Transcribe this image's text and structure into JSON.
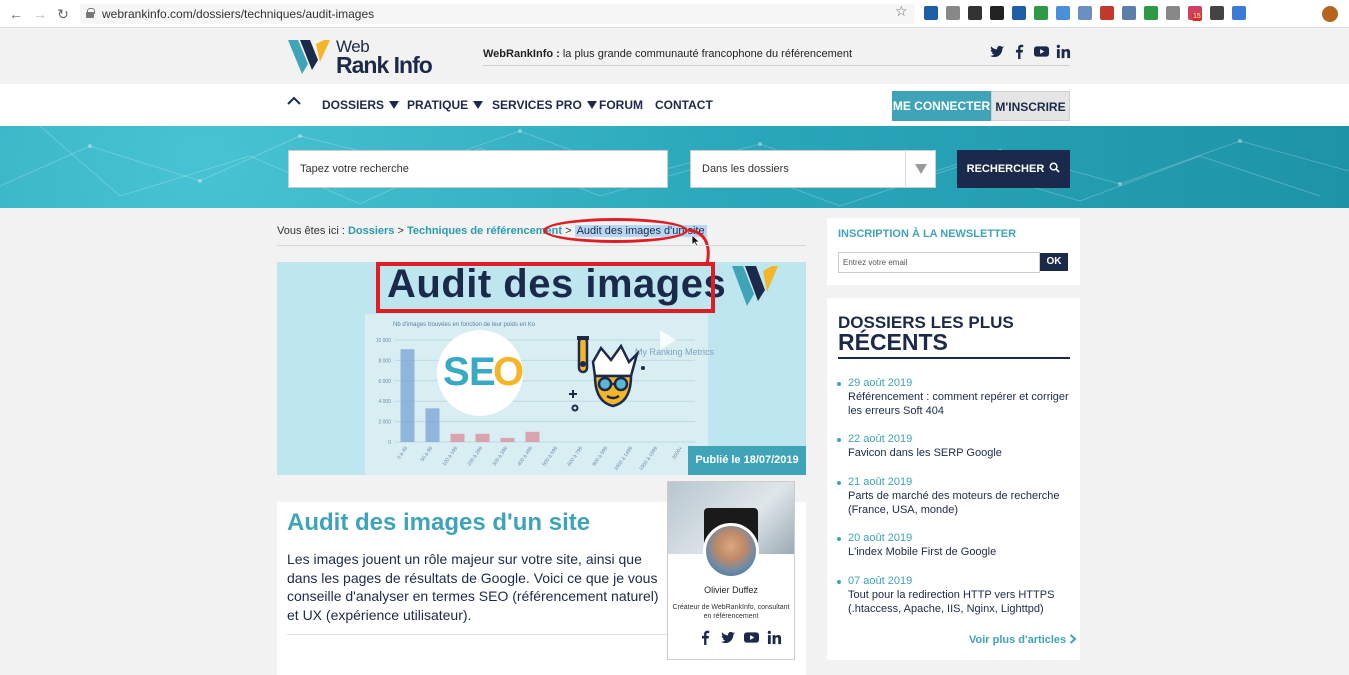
{
  "browser": {
    "url": "webrankinfo.com/dossiers/techniques/audit-images",
    "ext_badge": "15",
    "ext_colors": [
      "#1f5fa8",
      "#888888",
      "#333333",
      "#222222",
      "#1f5fa8",
      "#2e9a46",
      "#4a90d9",
      "#6a8fc0",
      "#c0392b",
      "#5b7fa8",
      "#2e9a46",
      "#888888",
      "#d04060",
      "#444444",
      "#3a7bd5"
    ]
  },
  "header": {
    "logo_web": "Web",
    "logo_rank_info": "Rank Info",
    "tagline_brand": "WebRankInfo :",
    "tagline_text": " la plus grande communauté francophone du référencement",
    "social": [
      "twitter-icon",
      "facebook-icon",
      "youtube-icon",
      "linkedin-icon"
    ]
  },
  "nav": {
    "items": [
      "DOSSIERS",
      "PRATIQUE",
      "SERVICES PRO",
      "FORUM",
      "CONTACT"
    ],
    "connect": "ME CONNECTER",
    "register": "M'INSCRIRE"
  },
  "search": {
    "placeholder": "Tapez votre recherche",
    "scope": "Dans les dossiers",
    "button": "RECHERCHER"
  },
  "breadcrumb": {
    "prefix": "Vous êtes ici : ",
    "level1": "Dossiers",
    "sep": " > ",
    "level2": "Techniques de référencement",
    "current": "Audit des images d'un site"
  },
  "hero_image": {
    "title": "Audit des images",
    "chart_caption": "Nb d'images trouvées en fonction de leur poids en Ko",
    "watermark": "My Ranking Metrics",
    "y_ticks": [
      "10 000",
      "8 000",
      "6 000",
      "4 000",
      "2 000",
      "0"
    ],
    "x_ticks": [
      "0 à 49",
      "50 à 99",
      "100 à 199",
      "200 à 299",
      "300 à 399",
      "400 à 499",
      "500 à 599",
      "600 à 799",
      "800 à 999",
      "1000 à 1499",
      "1500 à 1999",
      "2000+"
    ],
    "bars": [
      9100,
      3300,
      800,
      800,
      400,
      1000
    ],
    "seo": [
      "S",
      "E",
      "O"
    ]
  },
  "published": "Publié le 18/07/2019",
  "article": {
    "title": "Audit des images d'un site",
    "intro": "Les images jouent un rôle majeur sur votre site, ainsi que dans les pages de résultats de Google. Voici ce que je vous conseille d'analyser en termes SEO (référencement naturel) et UX (expérience utilisateur)."
  },
  "author": {
    "name": "Olivier Duffez",
    "role": "Créateur de WebRankInfo, consultant en référencement",
    "social": [
      "facebook-icon",
      "twitter-icon",
      "youtube-icon",
      "linkedin-icon"
    ]
  },
  "newsletter": {
    "title": "INSCRIPTION À LA NEWSLETTER",
    "placeholder": "Entrez votre email",
    "ok": "OK"
  },
  "recent": {
    "heading_small": "DOSSIERS LES PLUS",
    "heading_big": "RÉCENTS",
    "items": [
      {
        "date": "29 août 2019",
        "title": "Référencement : comment repérer et corriger les erreurs Soft 404"
      },
      {
        "date": "22 août 2019",
        "title": "Favicon dans les SERP Google"
      },
      {
        "date": "21 août 2019",
        "title": "Parts de marché des moteurs de recherche (France, USA, monde)"
      },
      {
        "date": "20 août 2019",
        "title": "L'index Mobile First de Google"
      },
      {
        "date": "07 août 2019",
        "title": "Tout pour la redirection HTTP vers HTTPS (.htaccess, Apache, IIS, Nginx, Lighttpd)"
      }
    ],
    "more": "Voir plus d'articles"
  },
  "colors": {
    "navy": "#1b2a4a",
    "teal": "#3fa4b7",
    "highlight_red": "#e01c24"
  }
}
